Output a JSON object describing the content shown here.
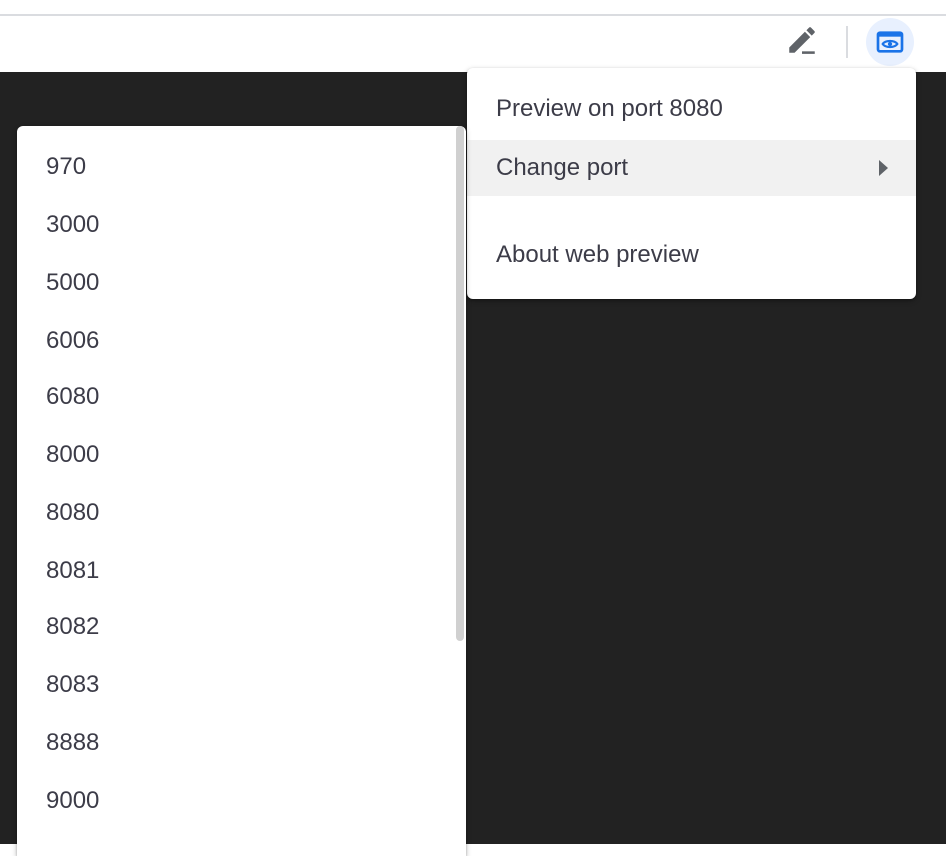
{
  "toolbar": {
    "edit_icon": "pencil-icon",
    "preview_icon": "web-preview-icon",
    "accent_color": "#1a73e8"
  },
  "menu": {
    "items": [
      {
        "label": "Preview on port 8080"
      },
      {
        "label": "Change port"
      },
      {
        "label": "About web preview"
      }
    ]
  },
  "port_list": {
    "ports": [
      "970",
      "3000",
      "5000",
      "6006",
      "6080",
      "8000",
      "8080",
      "8081",
      "8082",
      "8083",
      "8888",
      "9000"
    ]
  }
}
